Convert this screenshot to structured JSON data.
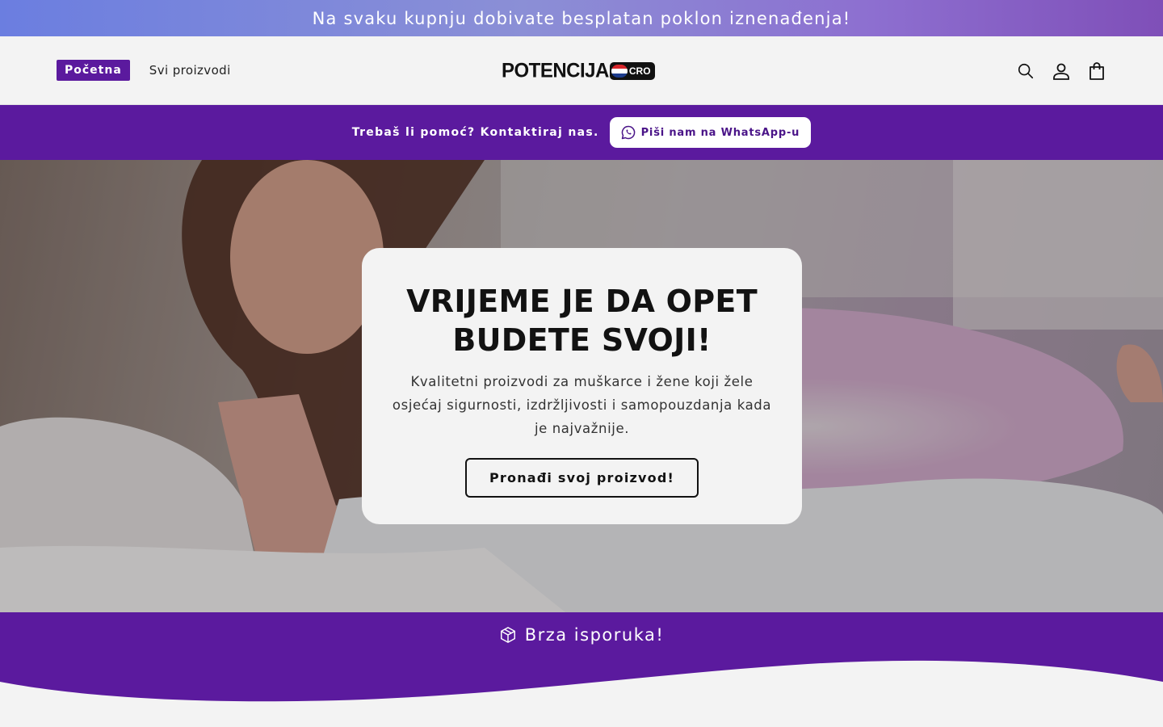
{
  "announcement": {
    "text": "Na svaku kupnju dobivate besplatan poklon iznenađenja!"
  },
  "header": {
    "nav": [
      {
        "label": "Početna",
        "active": true
      },
      {
        "label": "Svi proizvodi",
        "active": false
      }
    ],
    "logo": {
      "text": "POTENCIJA",
      "badge": "CRO"
    },
    "icons": [
      "search-icon",
      "account-icon",
      "cart-icon"
    ]
  },
  "help_bar": {
    "text": "Trebaš li pomoć? Kontaktiraj nas.",
    "button_label": "Piši nam na WhatsApp-u",
    "button_icon": "whatsapp-icon"
  },
  "hero": {
    "title": "VRIJEME JE DA OPET BUDETE SVOJI!",
    "subtitle": "Kvalitetni proizvodi za muškarce i žene koji žele osjećaj sigurnosti, izdržljivosti i samopouzdanja kada je najvažnije.",
    "cta_label": "Pronađi svoj proizvod!"
  },
  "delivery": {
    "text": "Brza isporuka!",
    "icon": "package-icon"
  },
  "colors": {
    "brand_purple": "#5b1a9e",
    "page_bg": "#f3f3f3",
    "announcement_gradient_start": "#6b7ee0",
    "announcement_gradient_end": "#7f4fb8"
  }
}
